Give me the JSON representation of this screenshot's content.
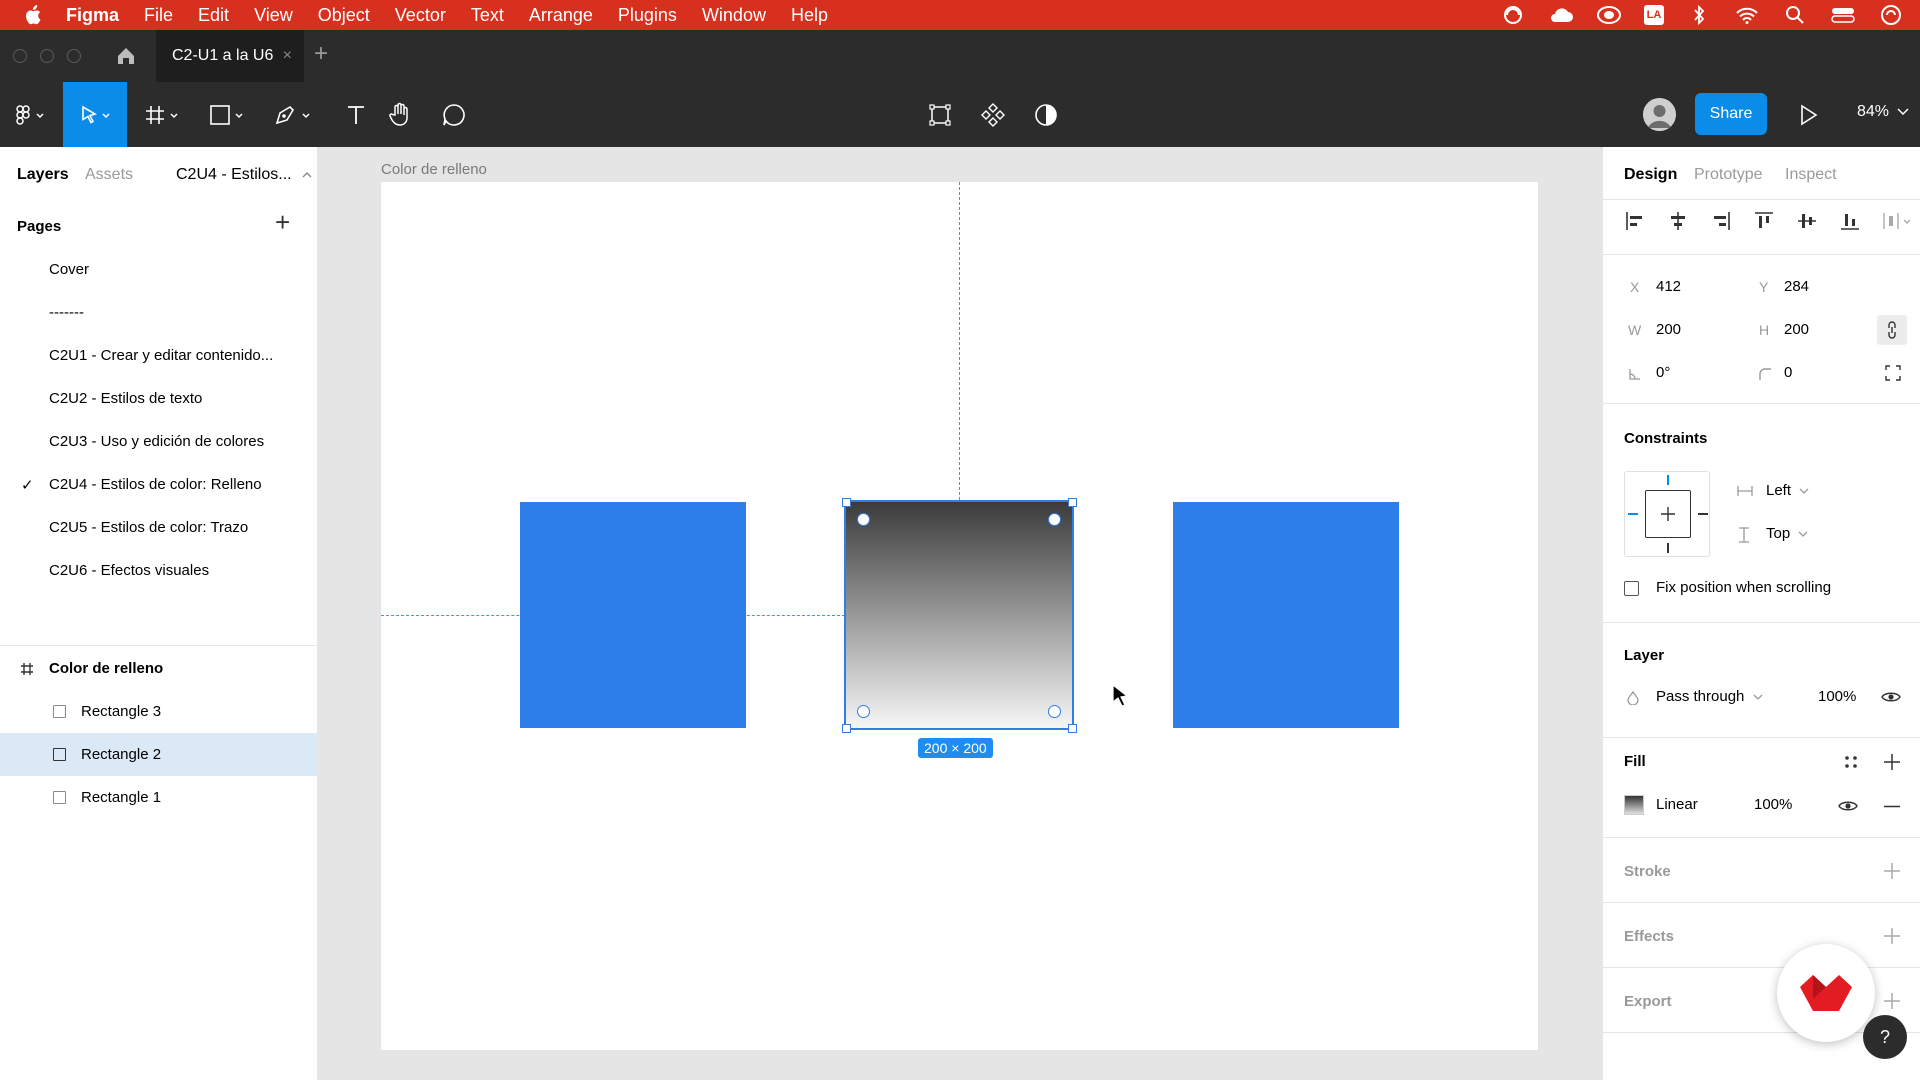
{
  "menubar": {
    "items": [
      "Figma",
      "File",
      "Edit",
      "View",
      "Object",
      "Vector",
      "Text",
      "Arrange",
      "Plugins",
      "Window",
      "Help"
    ],
    "tray_badge": "LA"
  },
  "tabbar": {
    "file_tab": "C2-U1 a la U6",
    "close_glyph": "×",
    "new_tab_glyph": "+"
  },
  "toolbar": {
    "share_label": "Share",
    "zoom": "84%"
  },
  "left_panel": {
    "tabs": [
      "Layers",
      "Assets"
    ],
    "current_page": "C2U4 - Estilos...",
    "pages_title": "Pages",
    "add_glyph": "+",
    "check_glyph": "✓",
    "pages": [
      "Cover",
      "-------",
      "C2U1 - Crear y editar contenido...",
      "C2U2 - Estilos de texto",
      "C2U3 - Uso y edición de colores",
      "C2U4 - Estilos de color: Relleno",
      "C2U5 - Estilos de color: Trazo",
      "C2U6 - Efectos visuales"
    ],
    "frame_layer": "Color de relleno",
    "layers": [
      "Rectangle 3",
      "Rectangle 2",
      "Rectangle 1"
    ]
  },
  "canvas": {
    "frame_label": "Color de relleno",
    "size_badge": "200 × 200",
    "rect_color": "#2d7ee8"
  },
  "right_panel": {
    "tabs": [
      "Design",
      "Prototype",
      "Inspect"
    ],
    "x_label": "X",
    "x_value": "412",
    "y_label": "Y",
    "y_value": "284",
    "w_label": "W",
    "w_value": "200",
    "h_label": "H",
    "h_value": "200",
    "rotation": "0°",
    "radius": "0",
    "constraints_title": "Constraints",
    "constraint_h": "Left",
    "constraint_v": "Top",
    "fix_position_label": "Fix position when scrolling",
    "layer_title": "Layer",
    "blend_mode": "Pass through",
    "layer_opacity": "100%",
    "fill_title": "Fill",
    "fill_type": "Linear",
    "fill_opacity": "100%",
    "stroke_title": "Stroke",
    "effects_title": "Effects",
    "export_title": "Export",
    "help_glyph": "?"
  }
}
